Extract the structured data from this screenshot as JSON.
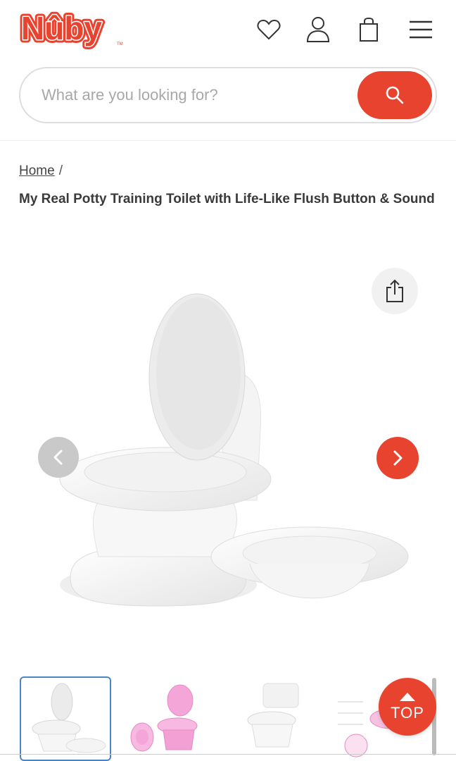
{
  "header": {
    "logo_text": "Nûby",
    "logo_tm": "TM"
  },
  "search": {
    "placeholder": "What are you looking for?"
  },
  "breadcrumb": {
    "home": "Home",
    "separator": "/"
  },
  "product": {
    "title": "My Real Potty Training Toilet with Life-Like Flush Button & Sound"
  },
  "scroll_top": {
    "label": "TOP"
  },
  "colors": {
    "brand_red": "#e8432f",
    "active_thumb_border": "#4a86c5"
  },
  "icons": [
    "heart-icon",
    "account-icon",
    "shopping-bag-icon",
    "menu-icon",
    "search-icon",
    "share-icon",
    "chevron-left-icon",
    "chevron-right-icon",
    "arrow-up-icon"
  ]
}
